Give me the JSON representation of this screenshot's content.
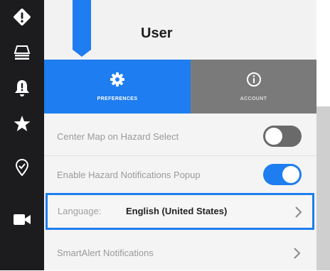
{
  "colors": {
    "rail": "#1c1c1e",
    "accent": "#1e7df0",
    "tab_inactive": "#7a7a7a",
    "panel": "#f4f4f4"
  },
  "rail": {
    "items": [
      {
        "icon": "hazard-diamond-icon"
      },
      {
        "icon": "layers-icon"
      },
      {
        "icon": "bell-alert-icon"
      },
      {
        "icon": "star-icon"
      },
      {
        "icon": "location-pin-icon"
      },
      {
        "icon": "video-camera-icon"
      }
    ]
  },
  "header": {
    "title": "User",
    "icon": "bookmark-icon"
  },
  "tabs": [
    {
      "label": "PREFERENCES",
      "icon": "gear-icon",
      "selected": true
    },
    {
      "label": "ACCOUNT",
      "icon": "info-icon",
      "selected": false
    }
  ],
  "settings": {
    "center_map": {
      "label": "Center Map on Hazard Select",
      "enabled": false
    },
    "notifications_popup": {
      "label": "Enable Hazard Notifications Popup",
      "enabled": true
    },
    "language": {
      "label": "Language:",
      "value": "English (United States)"
    },
    "smartalert": {
      "label": "SmartAlert Notifications"
    }
  }
}
